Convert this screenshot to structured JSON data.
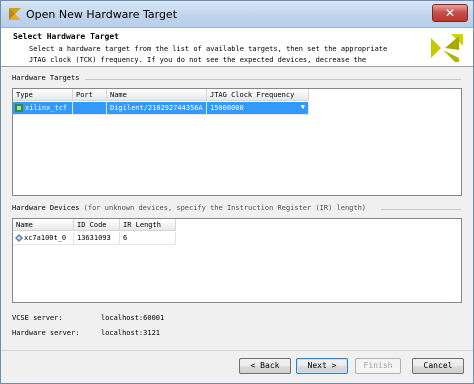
{
  "window": {
    "title": "Open New Hardware Target",
    "close_label": "✕"
  },
  "header": {
    "title": "Select Hardware Target",
    "description": "Select a hardware target from the list of available targets, then set the appropriate\nJTAG clock (TCK) frequency. If you do not see the expected devices, decrease the"
  },
  "hardware_targets": {
    "label": "Hardware Targets",
    "columns": [
      "Type",
      "Port",
      "Name",
      "JTAG Clock Frequency"
    ],
    "rows": [
      {
        "type": "xilinx_tcf",
        "port": "",
        "name": "Digilent/210292744356A",
        "frequency": "15000000"
      }
    ]
  },
  "hardware_devices": {
    "label": "Hardware Devices",
    "note": " (for unknown devices, specify the Instruction Register (IR) length)",
    "columns": [
      "Name",
      "ID Code",
      "IR Length"
    ],
    "rows": [
      {
        "name": "xc7a100t_0",
        "id_code": "13631093",
        "ir_length": "6"
      }
    ]
  },
  "servers": {
    "vcse_label": "VCSE server:",
    "vcse_value": "localhost:60001",
    "hw_label": "Hardware server:",
    "hw_value": "localhost:3121"
  },
  "buttons": {
    "back": "< Back",
    "next": "Next >",
    "finish": "Finish",
    "cancel": "Cancel"
  },
  "colors": {
    "selection": "#3399ff",
    "logo": "#c8c800"
  }
}
